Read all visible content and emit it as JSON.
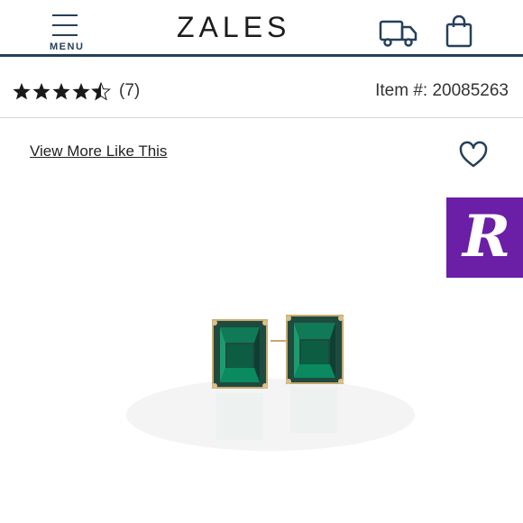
{
  "header": {
    "menu_label": "MENU",
    "logo_text": "ZALES",
    "icons": [
      "menu-icon",
      "truck-icon",
      "shopping-bag-icon"
    ],
    "accent_color": "#25405a"
  },
  "rating": {
    "stars": 4.5,
    "review_count": "(7)",
    "item_number": "Item #: 20085263"
  },
  "product": {
    "view_more_label": "View More Like This",
    "wishlist_icon": "heart-icon",
    "image_subject": "emerald-cut green stud earrings",
    "gem_color": "#0f6b4c"
  },
  "badge": {
    "letter": "R",
    "color": "#6a1fa6"
  }
}
